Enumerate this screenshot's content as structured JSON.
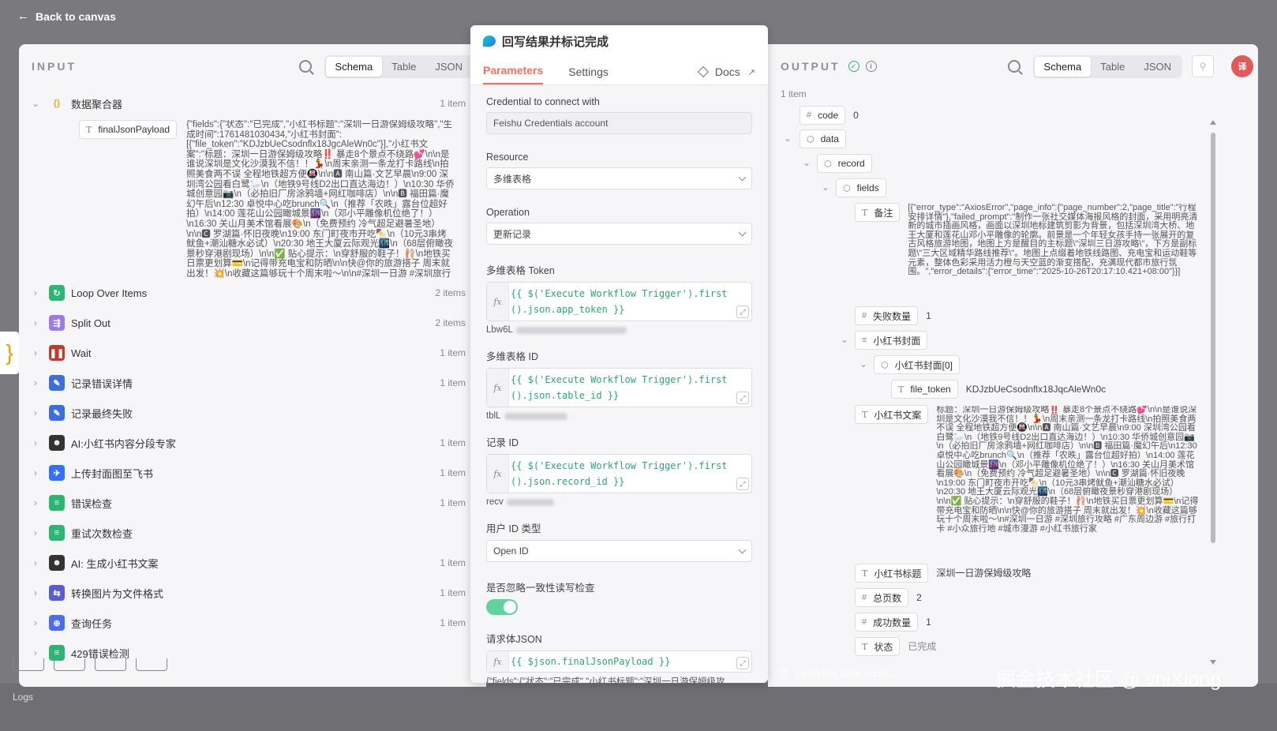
{
  "back_label": "Back to canvas",
  "input": {
    "title": "INPUT",
    "view_tabs": [
      "Schema",
      "Table",
      "JSON"
    ],
    "active_tab": "Schema",
    "nodes": [
      {
        "label": "数据聚合器",
        "count": "1 item",
        "icon": "braces-icon",
        "color": "#f5a623",
        "glyph": "{}",
        "expanded": true
      },
      {
        "label": "Loop Over Items",
        "count": "2 items",
        "icon": "loop-icon",
        "color": "#2bb673",
        "glyph": "↻"
      },
      {
        "label": "Split Out",
        "count": "2 items",
        "icon": "split-icon",
        "color": "#9c7be8",
        "glyph": "⇶"
      },
      {
        "label": "Wait",
        "count": "1 item",
        "icon": "pause-icon",
        "color": "#c0392b",
        "glyph": "❚❚"
      },
      {
        "label": "记录错误详情",
        "count": "1 item",
        "icon": "pencil-icon",
        "color": "#3b6fe0",
        "glyph": "✎"
      },
      {
        "label": "记录最终失败",
        "count": "",
        "icon": "pencil-icon",
        "color": "#3b6fe0",
        "glyph": "✎"
      },
      {
        "label": "AI:小红书内容分段专家",
        "count": "1 item",
        "icon": "robot-icon",
        "color": "#333333",
        "glyph": "☻"
      },
      {
        "label": "上传封面图至飞书",
        "count": "1 item",
        "icon": "feishu-icon",
        "color": "#3370ff",
        "glyph": "✈"
      },
      {
        "label": "错误检查",
        "count": "1 item",
        "icon": "if-icon",
        "color": "#2bb673",
        "glyph": "≡"
      },
      {
        "label": "重试次数检查",
        "count": "",
        "icon": "if-icon",
        "color": "#2bb673",
        "glyph": "≡"
      },
      {
        "label": "AI: 生成小红书文案",
        "count": "1 item",
        "icon": "robot-icon",
        "color": "#333333",
        "glyph": "☻"
      },
      {
        "label": "转换图片为文件格式",
        "count": "1 item",
        "icon": "convert-icon",
        "color": "#5b5bd6",
        "glyph": "⇆"
      },
      {
        "label": "查询任务",
        "count": "1 item",
        "icon": "globe-icon",
        "color": "#4a6cf7",
        "glyph": "⊕"
      },
      {
        "label": "429错误检测",
        "count": "",
        "icon": "if-icon",
        "color": "#2bb673",
        "glyph": "≡"
      }
    ],
    "field": {
      "name": "finalJsonPayload",
      "type_icon": "T",
      "value": "{\"fields\":{\"状态\":\"已完成\",\"小红书标题\":\"深圳一日游保姆级攻略\",\"生成时间\":1761481030434,\"小红书封面\":[{\"file_token\":\"KDJzbUeCsodnflx18JgcAleWn0c\"}],\"小红书文案\":\"标题：深圳一日游保姆级攻略‼️ 暴走8个景点不绕路💕\\n\\n是谁说深圳是文化沙漠我不信！！💃\\n周末亲测一条龙打卡路线\\n拍照美食两不误 全程地铁超方便🚇\\n\\n🅰 南山篇·文艺早晨\\n9:00 深圳湾公园看白鹭🦢\\n（地铁9号线D2出口直达海边！）\\n10:30 华侨城创意园📷\\n（必拍旧厂房涂鸦墙+网红咖啡店）\\n\\n🅱 福田篇·魔幻午后\\n12:30 卓悦中心吃brunch🔍\\n（推荐「农昳」露台位超好拍）\\n14:00 莲花山公园瞰城景🌆\\n（邓小平雕像机位绝了！）\\n16:30 关山月美术馆看展🎨\\n（免费预约 冷气超足避暑圣地）\\n\\n🅲 罗湖篇·怀旧夜晚\\n19:00 东门町夜市开吃🍢\\n（10元3串烤鱿鱼+潮汕糖水必试）\\n20:30 地王大厦云际观光🌃\\n（68层俯瞰夜景秒穿港剧现场）\\n\\n✅ 贴心提示：\\n穿舒服的鞋子！🩰\\n地铁买日票更划算💳\\n记得带充电宝和防晒\\n\\n快@你的旅游搭子 周末就出发！💥\\n收藏这篇够玩十个周末啦～\\n\\n#深圳一日游 #深圳旅行攻略 #周末去哪儿 …"
    }
  },
  "modal": {
    "title": "回写结果并标记完成",
    "tabs": [
      "Parameters",
      "Settings"
    ],
    "active_tab": "Parameters",
    "docs_label": "Docs",
    "credential_label": "Credential to connect with",
    "credential_value": "Feishu Credentials account",
    "resource_label": "Resource",
    "resource_value": "多维表格",
    "operation_label": "Operation",
    "operation_value": "更新记录",
    "token_label": "多维表格 Token",
    "token_expr": "{{ $('Execute Workflow Trigger').first().json.app_token }}",
    "token_hint": "Lbw6L",
    "table_label": "多维表格 ID",
    "table_expr": "{{ $('Execute Workflow Trigger').first().json.table_id }}",
    "table_hint": "tblL",
    "record_label": "记录 ID",
    "record_expr": "{{ $('Execute Workflow Trigger').first().json.record_id }}",
    "record_hint": "recv",
    "userid_label": "用户 ID 类型",
    "userid_value": "Open ID",
    "ignore_label": "是否忽略一致性读写检查",
    "ignore_on": true,
    "body_label": "请求体JSON",
    "body_expr": "{{ $json.finalJsonPayload }}",
    "body_hint": "{\"fields\":{\"状态\":\"已完成\",\"小红书标题\":\"深圳一日游保姆级攻..."
  },
  "output": {
    "title": "OUTPUT",
    "view_tabs": [
      "Schema",
      "Table",
      "JSON"
    ],
    "active_tab": "Schema",
    "item_count": "1 item",
    "code_key": "code",
    "code_val": "0",
    "data_key": "data",
    "record_key": "record",
    "fields_key": "fields",
    "beizhu_key": "备注",
    "beizhu_val": "[{\"error_type\":\"AxiosError\",\"page_info\":{\"page_number\":2,\"page_title\":\"行程安排详情\"},\"failed_prompt\":\"制作一张社交媒体海报风格的封面，采用明亮清新的城市插画风格，画面以深圳地标建筑剪影为背景，包括深圳湾大桥、地王大厦和莲花山邓小平雕像的轮廓。前景是一个年轻女孩手持一张展开的复古风格旅游地图，地图上方是醒目的主标题\\\"深圳三日游攻略\\\"，下方是副标题\\\"三大区域精华路线推荐\\\"。地图上点缀着地铁线路图、充电宝和运动鞋等元素，整体色彩采用活力橙与天空蓝的渐变搭配，充满现代都市旅行氛围。\",\"error_details\":{\"error_time\":\"2025-10-26T20:17:10.421+08:00\"}}]",
    "fail_key": "失败数量",
    "fail_val": "1",
    "cover_key": "小红书封面",
    "cover0_key": "小红书封面[0]",
    "file_token_key": "file_token",
    "file_token_val": "KDJzbUeCsodnflx18JqcAleWn0c",
    "copy_key": "小红书文案",
    "copy_val": "标题：深圳一日游保姆级攻略‼️ 暴走8个景点不绕路💕\\n\\n是谁说深圳是文化沙漠我不信！！💃\\n周末亲测一条龙打卡路线\\n拍照美食两不误 全程地铁超方便🚇\\n\\n🅰 南山篇·文艺早晨\\n9:00 深圳湾公园看白鹭🦢\\n（地铁9号线D2出口直达海边！）\\n10:30 华侨城创意园📷\\n（必拍旧厂房涂鸦墙+网红咖啡店）\\n\\n🅱 福田篇·魔幻午后\\n12:30 卓悦中心吃brunch🔍\\n（推荐「农昳」露台位超好拍）\\n14:00 莲花山公园瞰城景🌆\\n（邓小平雕像机位绝了！）\\n16:30 关山月美术馆看展🎨\\n（免费预约 冷气超足避暑圣地）\\n\\n🅲 罗湖篇·怀旧夜晚\\n19:00 东门町夜市开吃🍢\\n（10元3串烤鱿鱼+潮汕糖水必试）\\n20:30 地王大厦云际观光🌃\\n（68层俯瞰夜景秒穿港剧现场）\\n\\n✅ 贴心提示：\\n穿舒服的鞋子！🩰\\n地铁买日票更划算💳\\n记得带充电宝和防晒\\n\\n快@你的旅游搭子 周末就出发！💥\\n收藏这篇够玩十个周末啦～\\n#深圳一日游 #深圳旅行攻略 #广东周边游 #旅行打卡 #小众旅行地 #城市漫游 #小红书旅行家",
    "title_key": "小红书标题",
    "title_val": "深圳一日游保姆级攻略",
    "total_key": "总页数",
    "total_val": "2",
    "success_key": "成功数量",
    "success_val": "1",
    "status_key": "状态",
    "status_val": "已完成"
  },
  "wish_label": "I wish this node would...",
  "watermark": "掘金技术社区 @ vniXiong",
  "logs_label": "Logs",
  "translate_label": "译"
}
